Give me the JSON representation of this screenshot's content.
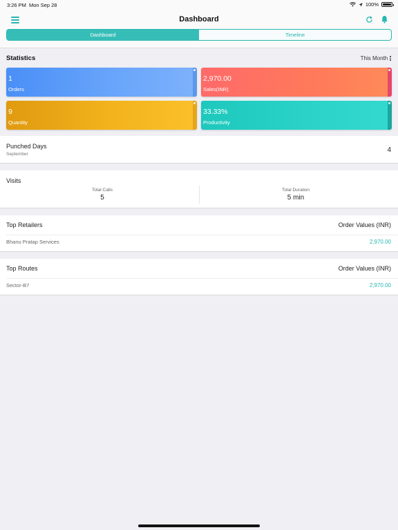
{
  "status_bar": {
    "time": "3:26 PM",
    "date": "Mon Sep 28",
    "battery": "100%"
  },
  "header": {
    "title": "Dashboard"
  },
  "segments": [
    {
      "label": "Dashboard",
      "active": true
    },
    {
      "label": "Timeline",
      "active": false
    }
  ],
  "statistics": {
    "title": "Statistics",
    "period": "This Month",
    "cards": {
      "orders": {
        "value": "1",
        "label": "Orders",
        "color": "#5a9cf8"
      },
      "sales": {
        "value": "2,970.00",
        "label": "Sales(INR)",
        "color": "#ff7160"
      },
      "quantity": {
        "value": "9",
        "label": "Quantity",
        "color": "#f2b31c"
      },
      "productivity": {
        "value": "33.33%",
        "label": "Productivity",
        "color": "#27cfc4"
      }
    }
  },
  "punched_days": {
    "title": "Punched Days",
    "month": "September",
    "count": "4"
  },
  "visits": {
    "title": "Visits",
    "total_calls_label": "Total Calls",
    "total_calls": "5",
    "total_duration_label": "Total Duration",
    "total_duration": "5 min"
  },
  "top_retailers": {
    "title": "Top Retailers",
    "value_header": "Order Values (INR)",
    "rows": [
      {
        "name": "Bhanu Pratap Services",
        "value": "2,970.00"
      }
    ]
  },
  "top_routes": {
    "title": "Top Routes",
    "value_header": "Order Values (INR)",
    "rows": [
      {
        "name": "Sector-B7",
        "value": "2,970.00"
      }
    ]
  },
  "accent_color": "#26b6b2"
}
